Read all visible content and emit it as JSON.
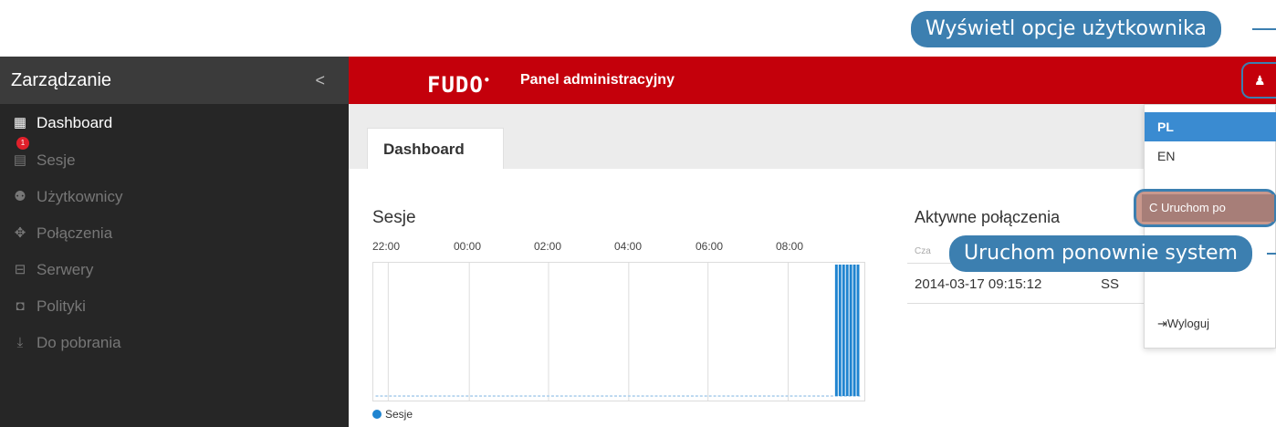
{
  "callouts": {
    "user_options": "Wyświetl opcje użytkownika",
    "restart_system": "Uruchom ponownie system"
  },
  "sidebar": {
    "title": "Zarządzanie",
    "collapse_glyph": "<",
    "items": [
      {
        "label": "Dashboard",
        "icon": "dashboard-icon",
        "active": true
      },
      {
        "label": "Sesje",
        "icon": "sessions-icon",
        "badge": "1"
      },
      {
        "label": "Użytkownicy",
        "icon": "users-icon"
      },
      {
        "label": "Połączenia",
        "icon": "connections-icon"
      },
      {
        "label": "Serwery",
        "icon": "servers-icon"
      },
      {
        "label": "Polityki",
        "icon": "policies-icon"
      },
      {
        "label": "Do pobrania",
        "icon": "download-icon"
      }
    ]
  },
  "header": {
    "logo": "FUDO",
    "title": "Panel administracyjny",
    "brand_color": "#c4000b"
  },
  "tabs": [
    {
      "label": "Dashboard"
    }
  ],
  "sessions_panel": {
    "title": "Sesje",
    "legend": "Sesje"
  },
  "chart_data": {
    "type": "bar",
    "title": "Sesje",
    "x_ticks": [
      "22:00",
      "00:00",
      "02:00",
      "04:00",
      "06:00",
      "08:00"
    ],
    "series": [
      {
        "name": "Sesje",
        "color": "#1f84d0"
      }
    ],
    "grid": true
  },
  "connections_panel": {
    "title": "Aktywne połączenia",
    "header_partial": "Cza",
    "rows": [
      {
        "time": "2014-03-17 09:15:12",
        "type_partial": "SS"
      }
    ]
  },
  "user_menu": {
    "languages": [
      "PL",
      "EN"
    ],
    "selected_language": "PL",
    "restart_label": "C Uruchom po",
    "logout_label": "Wyloguj"
  }
}
